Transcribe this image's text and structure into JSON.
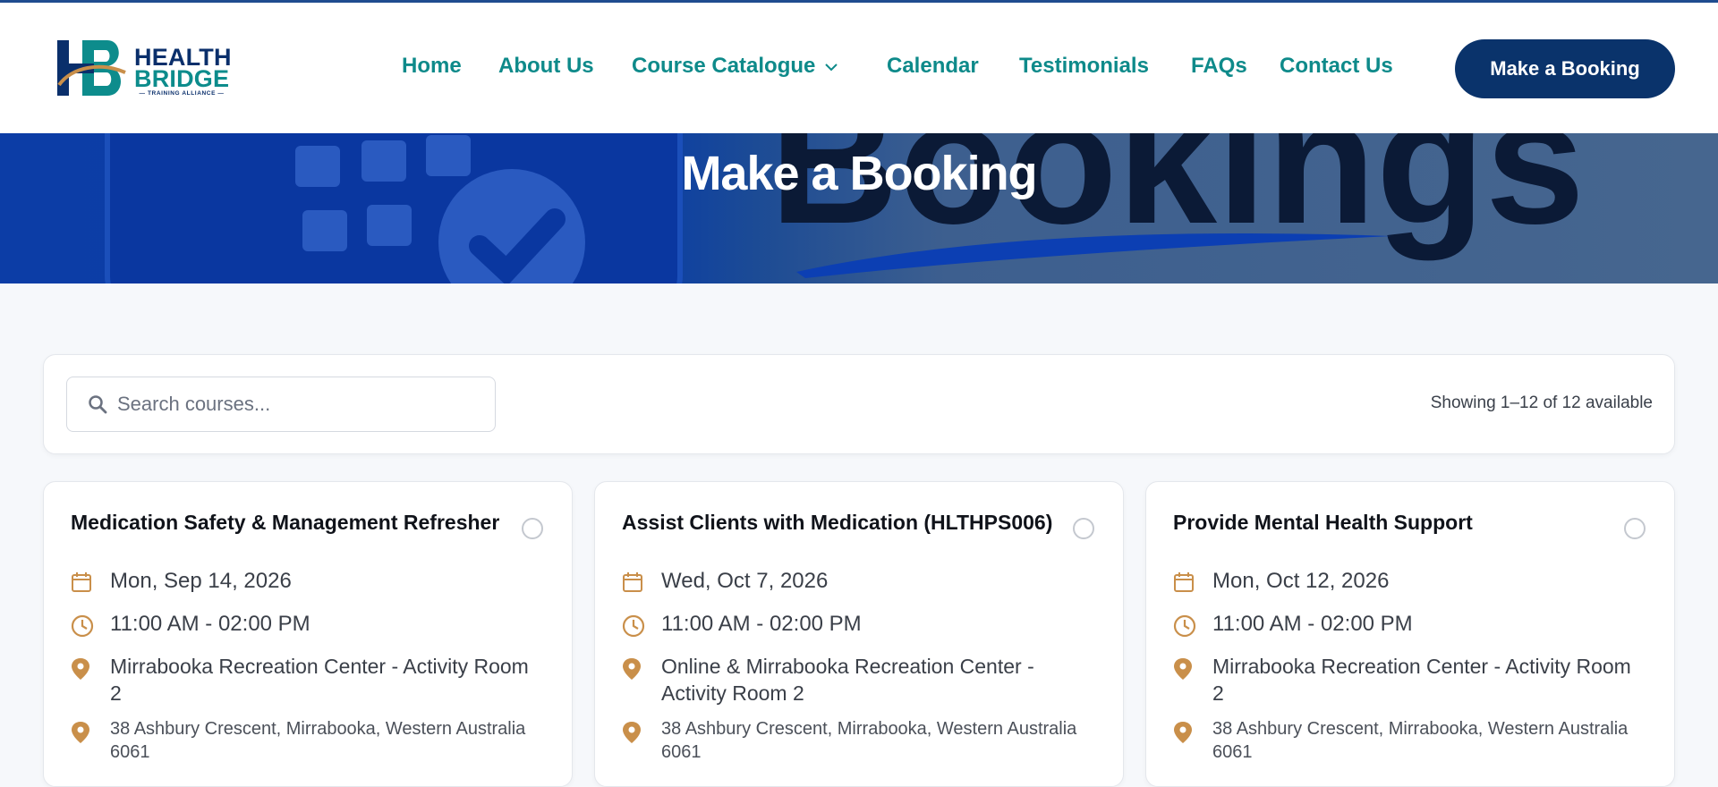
{
  "brand": {
    "line1": "HEALTH",
    "line2": "BRIDGE",
    "tagline": "— TRAINING ALLIANCE —",
    "colors": {
      "navy": "#0a2f6b",
      "teal": "#0d8c8c",
      "gold": "#c98f4a"
    }
  },
  "nav": {
    "items": [
      "Home",
      "About Us",
      "Course Catalogue",
      "Calendar",
      "Testimonials",
      "FAQs",
      "Contact Us"
    ],
    "cta": "Make a Booking"
  },
  "hero": {
    "title": "Make a Booking",
    "background_word": "Bookings"
  },
  "search": {
    "placeholder": "Search courses...",
    "value": ""
  },
  "results": {
    "showing": "Showing 1–12 of 12 available"
  },
  "icons": {
    "calendar": "calendar-icon",
    "clock": "clock-icon",
    "location": "map-pin-icon",
    "search": "search-icon"
  },
  "courses": [
    {
      "title": "Medication Safety & Management Refresher",
      "date": "Mon, Sep 14, 2026",
      "time": "11:00 AM - 02:00 PM",
      "location": "Mirrabooka Recreation Center - Activity Room 2",
      "address": "38 Ashbury Crescent, Mirrabooka, Western Australia 6061"
    },
    {
      "title": "Assist Clients with Medication (HLTHPS006)",
      "date": "Wed, Oct 7, 2026",
      "time": "11:00 AM - 02:00 PM",
      "location": "Online & Mirrabooka Recreation Center - Activity Room 2",
      "address": "38 Ashbury Crescent, Mirrabooka, Western Australia 6061"
    },
    {
      "title": "Provide Mental Health Support",
      "date": "Mon, Oct 12, 2026",
      "time": "11:00 AM - 02:00 PM",
      "location": "Mirrabooka Recreation Center - Activity Room 2",
      "address": "38 Ashbury Crescent, Mirrabooka, Western Australia 6061"
    }
  ]
}
